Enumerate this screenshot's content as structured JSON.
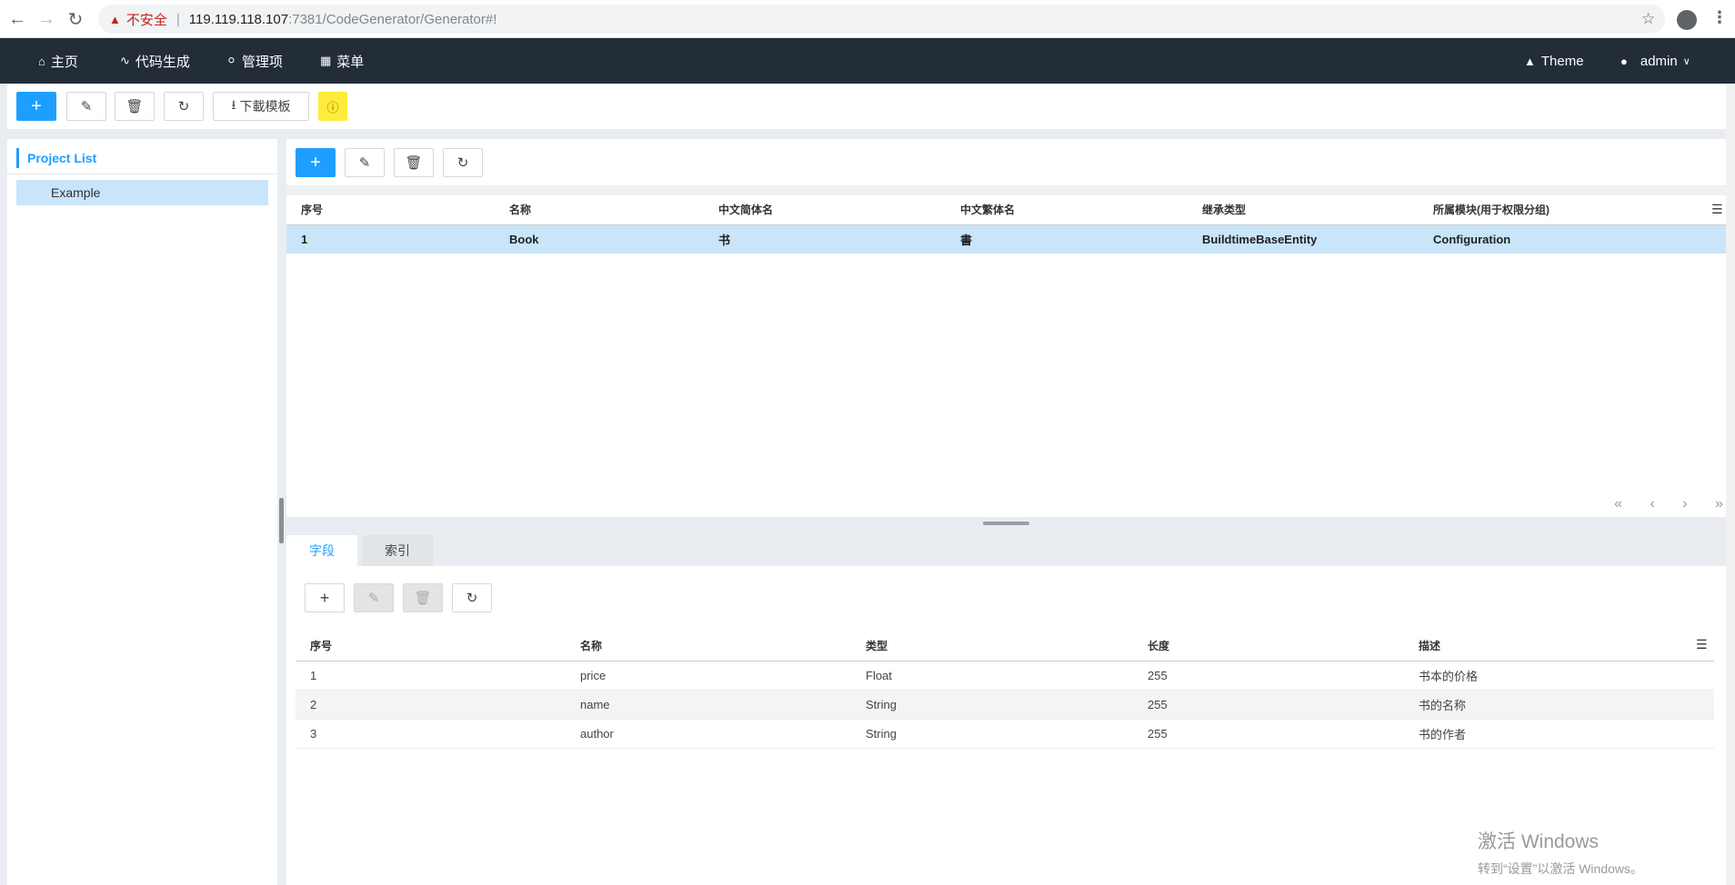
{
  "browser": {
    "security_label": "不安全",
    "url_host": "119.119.118.107",
    "url_rest": ":7381/CodeGenerator/Generator#!"
  },
  "nav": {
    "items": [
      {
        "label": "主页",
        "icon": "home-icon"
      },
      {
        "label": "代码生成",
        "icon": "chart-icon"
      },
      {
        "label": "管理项",
        "icon": "user-icon"
      },
      {
        "label": "菜单",
        "icon": "grid-icon"
      }
    ],
    "theme_label": "Theme",
    "user_label": "admin"
  },
  "toolbar": {
    "download_label": "下載模板"
  },
  "project_panel": {
    "title": "Project List",
    "items": [
      "Example"
    ]
  },
  "entity_table": {
    "columns": [
      "序号",
      "名称",
      "中文简体名",
      "中文繁体名",
      "继承类型",
      "所属模块(用于权限分组)"
    ],
    "rows": [
      [
        "1",
        "Book",
        "书",
        "書",
        "BuildtimeBaseEntity",
        "Configuration"
      ]
    ]
  },
  "tabs": [
    {
      "label": "字段",
      "active": true
    },
    {
      "label": "索引",
      "active": false
    }
  ],
  "field_table": {
    "columns": [
      "序号",
      "名称",
      "类型",
      "长度",
      "描述"
    ],
    "rows": [
      [
        "1",
        "price",
        "Float",
        "255",
        "书本的价格"
      ],
      [
        "2",
        "name",
        "String",
        "255",
        "书的名称"
      ],
      [
        "3",
        "author",
        "String",
        "255",
        "书的作者"
      ]
    ]
  },
  "watermark": {
    "line1": "激活 Windows",
    "line2": "转到“设置”以激活 Windows。"
  },
  "colors": {
    "nav_bg": "#222d38",
    "primary": "#1e9fff",
    "selected_row": "#c9e5fa",
    "help_button": "#ffeb3b"
  }
}
